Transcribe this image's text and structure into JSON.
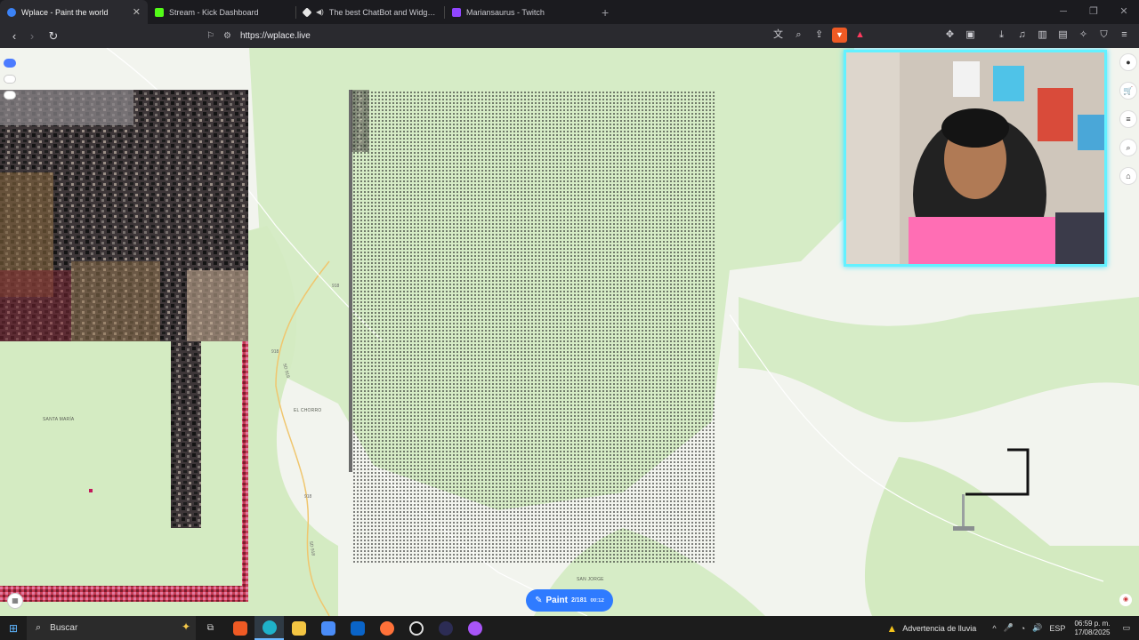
{
  "browser": {
    "tabs": [
      {
        "label": "Wplace - Paint the world",
        "active": true,
        "color": "#3b82f6"
      },
      {
        "label": "Stream - Kick Dashboard",
        "active": false,
        "color": "#53fc18"
      },
      {
        "label": "The best ChatBot and Widgets fo",
        "active": false,
        "color": "#e6e6e6"
      },
      {
        "label": "Mariansaurus - Twitch",
        "active": false,
        "color": "#9146ff"
      }
    ],
    "new_tab": "+",
    "close_tab": "✕",
    "url": "https://wplace.live"
  },
  "map": {
    "places": [
      "SANTA MARÍA",
      "EL CHORRO",
      "SAN JORGE"
    ],
    "roads": [
      "918",
      "918",
      "918",
      "SD 918",
      "SD 918"
    ],
    "paint_button": {
      "label": "Paint",
      "count": "2/181",
      "timer": "00:12"
    }
  },
  "taskbar": {
    "search_placeholder": "Buscar",
    "weather": "Advertencia de lluvia",
    "language": "ESP",
    "time": "06:59 p. m.",
    "date": "17/08/2025"
  }
}
